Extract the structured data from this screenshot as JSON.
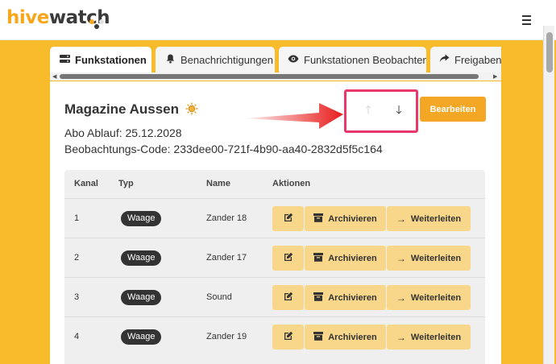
{
  "app": {
    "logo_hive": "hive",
    "logo_watch": "watch",
    "menu_icon": "hamburger-menu-icon",
    "logo_dot_colors": [
      "#f8a61c",
      "#3a3a3a",
      "#e0e0e0"
    ]
  },
  "tabs": [
    {
      "label": "Funkstationen",
      "icon": "radio-station-icon",
      "active": true
    },
    {
      "label": "Benachrichtigungen",
      "icon": "bell-icon",
      "active": false
    },
    {
      "label": "Funkstationen Beobachten",
      "icon": "eye-icon",
      "active": false
    },
    {
      "label": "Freigaben",
      "icon": "share-icon",
      "active": false
    }
  ],
  "station": {
    "title": "Magazine Aussen",
    "title_icon": "sun-icon",
    "abo_label": "Abo Ablauf: 25.12.2028",
    "code_label": "Beobachtungs-Code: 233dee00-721f-4b90-aa40-2832d5f5c164",
    "edit_button": "Bearbeiten",
    "sort_up_icon": "arrow-up-icon",
    "sort_down_icon": "arrow-down-icon"
  },
  "table": {
    "headers": {
      "kanal": "Kanal",
      "typ": "Typ",
      "name": "Name",
      "aktionen": "Aktionen"
    },
    "actions": {
      "archive": "Archivieren",
      "forward": "Weiterleiten"
    },
    "rows": [
      {
        "kanal": "1",
        "typ": "Waage",
        "name": "Zander 18"
      },
      {
        "kanal": "2",
        "typ": "Waage",
        "name": "Zander 17"
      },
      {
        "kanal": "3",
        "typ": "Waage",
        "name": "Sound"
      },
      {
        "kanal": "4",
        "typ": "Waage",
        "name": "Zander 19"
      }
    ]
  },
  "colors": {
    "brand_yellow": "#f8bb2b",
    "accent_orange": "#f3a724",
    "action_button": "#f9d78a",
    "annotation_pink": "#e8386a",
    "annotation_red": "#e81b1b"
  }
}
